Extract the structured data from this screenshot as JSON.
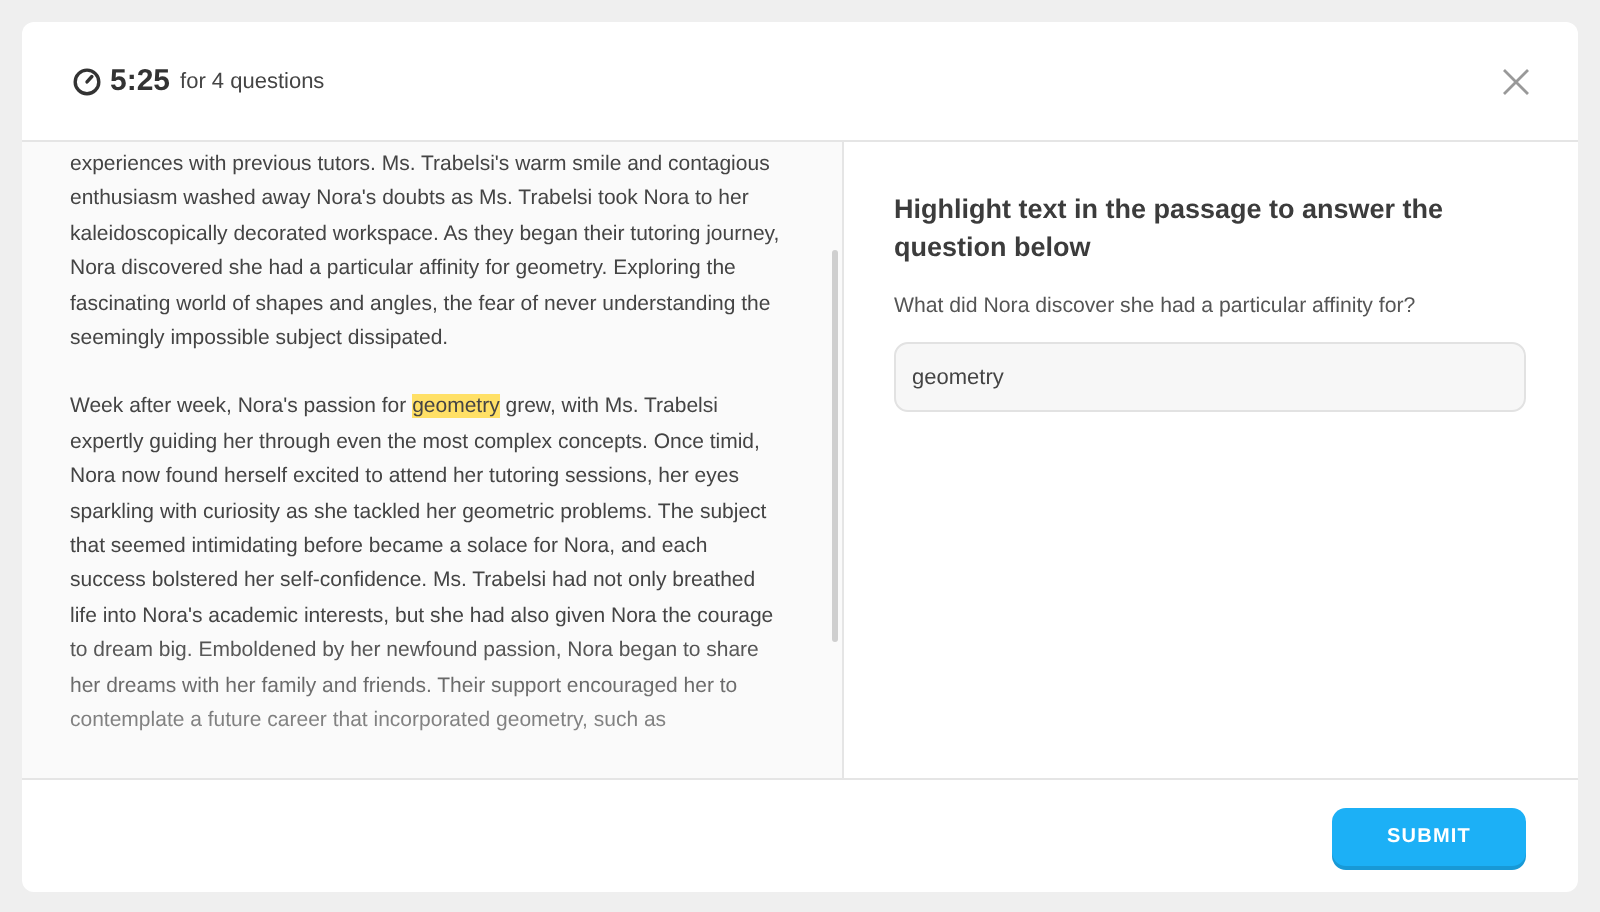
{
  "header": {
    "timer": "5:25",
    "timer_note": "for 4 questions"
  },
  "passage": [
    {
      "segments": [
        {
          "text": "experiences with previous tutors. Ms. Trabelsi's warm smile and contagious enthusiasm washed away Nora's doubts as Ms. Trabelsi took Nora to her kaleidoscopically decorated workspace. As they began their tutoring journey, Nora discovered she had a particular affinity for geometry. Exploring the fascinating world of shapes and angles, the fear of never understanding the seemingly impossible subject dissipated.",
          "highlighted": false
        }
      ]
    },
    {
      "segments": [
        {
          "text": "Week after week, Nora's passion for ",
          "highlighted": false
        },
        {
          "text": "geometry",
          "highlighted": true
        },
        {
          "text": " grew, with Ms. Trabelsi expertly guiding her through even the most complex concepts. Once timid, Nora now found herself excited to attend her tutoring sessions, her eyes sparkling with curiosity as she tackled her geometric problems. The subject that seemed intimidating before became a solace for Nora, and each success bolstered her self-confidence. Ms. Trabelsi had not only breathed life into Nora's academic interests, but she had also given Nora the courage to dream big. Emboldened by her newfound passion, Nora began to share her dreams with her family and friends. Their support encouraged her to contemplate a future career that incorporated geometry, such as",
          "highlighted": false
        }
      ]
    }
  ],
  "question": {
    "instruction": "Highlight text in the passage to answer the question below",
    "prompt": "What did Nora discover she had a particular affinity for?",
    "answer": "geometry"
  },
  "submit": "SUBMIT"
}
